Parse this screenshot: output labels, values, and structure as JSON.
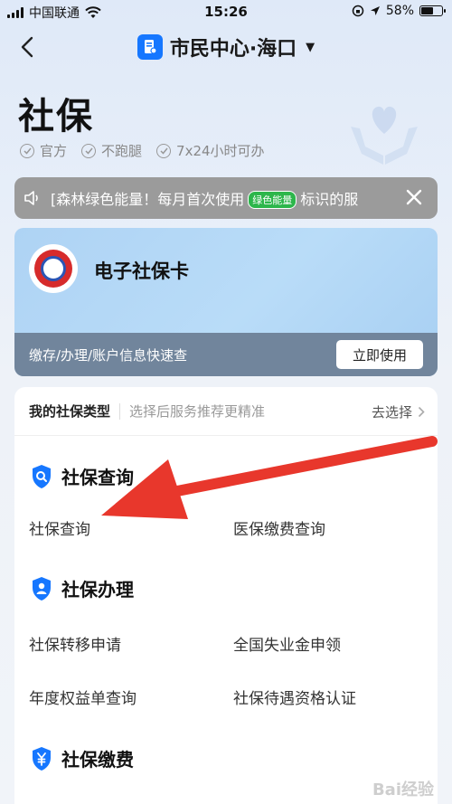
{
  "status_bar": {
    "carrier": "中国联通",
    "time": "15:26",
    "battery": "58%",
    "battery_level": 0.58
  },
  "nav": {
    "title": "市民中心·海口",
    "back_icon": "chevron-left-icon",
    "caret_icon": "caret-down-icon"
  },
  "header": {
    "title": "社保",
    "tags": [
      "官方",
      "不跑腿",
      "7x24小时可办"
    ]
  },
  "notice": {
    "text_before": "[森林绿色能量！每月首次使用",
    "badge": "绿色能量",
    "text_after": "标识的服"
  },
  "card": {
    "title": "电子社保卡",
    "subtitle": "缴存/办理/账户信息快速查",
    "button": "立即使用"
  },
  "type_row": {
    "label": "我的社保类型",
    "hint": "选择后服务推荐更精准",
    "action": "去选择"
  },
  "sections": [
    {
      "title": "社保查询",
      "icon": "search-shield-icon",
      "items": [
        "社保查询",
        "医保缴费查询"
      ]
    },
    {
      "title": "社保办理",
      "icon": "user-shield-icon",
      "items": [
        "社保转移申请",
        "全国失业金申领",
        "年度权益单查询",
        "社保待遇资格认证"
      ]
    },
    {
      "title": "社保缴费",
      "icon": "yuan-shield-icon",
      "items": []
    }
  ],
  "watermark": "Bai经验",
  "colors": {
    "accent": "#1677ff",
    "arrow": "#e8372c",
    "card_bg": "#aed3f4",
    "card_bar": "#71859c",
    "badge_green": "#2db64b"
  }
}
